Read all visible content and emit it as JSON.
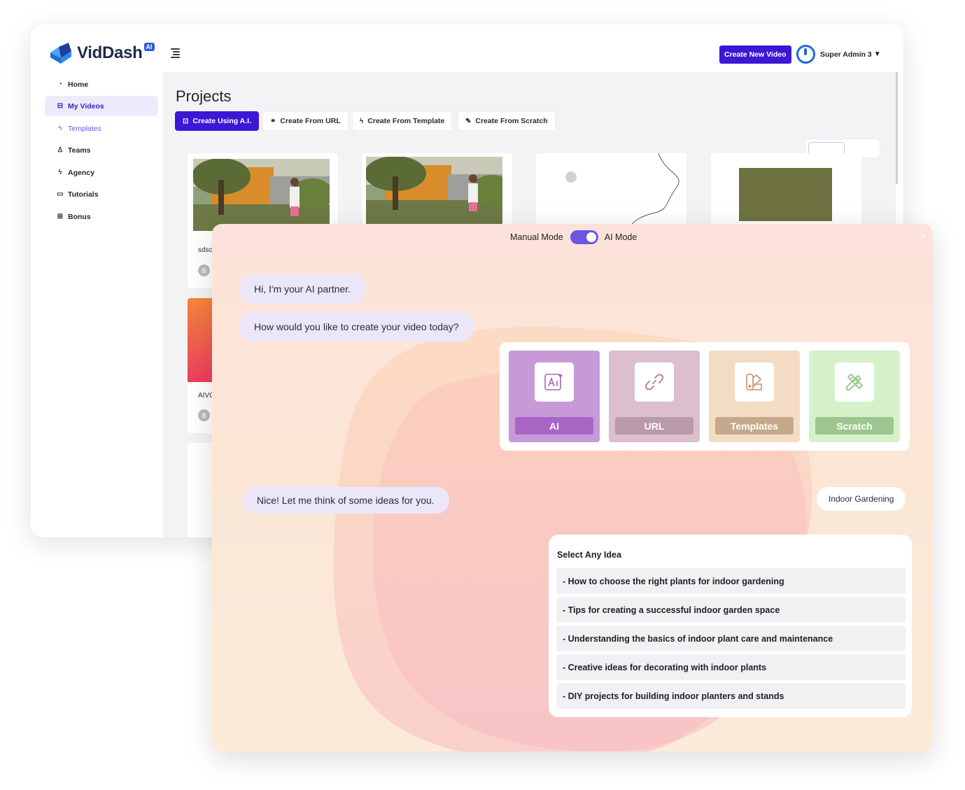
{
  "app": {
    "brand": "VidDash",
    "brand_badge": "AI",
    "create_new_label": "Create New Video",
    "user_name": "Super Admin 3",
    "user_caret": "▼"
  },
  "sidebar": {
    "items": [
      {
        "label": "Home",
        "icon": "dashboard-icon"
      },
      {
        "label": "My Videos",
        "icon": "videos-icon",
        "active": true
      },
      {
        "label": "Templates",
        "icon": "bolt-icon"
      },
      {
        "label": "Teams",
        "icon": "user-icon"
      },
      {
        "label": "Agency",
        "icon": "bolt-icon"
      },
      {
        "label": "Tutorials",
        "icon": "video-camera-icon"
      },
      {
        "label": "Bonus",
        "icon": "gift-icon"
      }
    ]
  },
  "projects": {
    "title": "Projects",
    "tabs": [
      {
        "label": "Create Using A.I.",
        "icon": "ai-icon"
      },
      {
        "label": "Create From URL",
        "icon": "link-icon"
      },
      {
        "label": "Create From Template",
        "icon": "bolt-icon"
      },
      {
        "label": "Create From Scratch",
        "icon": "pencil-icon"
      }
    ],
    "cards": [
      {
        "title": "sdsc",
        "avatar": "S"
      },
      {
        "title": "AIVC",
        "avatar": "S"
      }
    ]
  },
  "ai_panel": {
    "close_label": "×",
    "manual_mode_label": "Manual Mode",
    "ai_mode_label": "AI Mode",
    "ai_mode_on": true,
    "messages": [
      "Hi, I'm your AI partner.",
      "How would you like to create your video today?",
      "Nice! Let me think of some ideas for you."
    ],
    "user_reply": "Indoor Gardening",
    "choices": [
      {
        "label": "AI",
        "icon": "ai-sparkle-icon",
        "bg": "#c79ad7",
        "label_bg": "#a965c6",
        "icon_color": "#a762c4"
      },
      {
        "label": "URL",
        "icon": "link-icon",
        "bg": "#dbbfcc",
        "label_bg": "#b89aa9",
        "icon_color": "#b98fa8"
      },
      {
        "label": "Templates",
        "icon": "palette-icon",
        "bg": "#f3dcc4",
        "label_bg": "#c5a98a",
        "icon_color": "#c4a280"
      },
      {
        "label": "Scratch",
        "icon": "pencil-ruler-icon",
        "bg": "#d6f1c9",
        "label_bg": "#9dc58f",
        "icon_color": "#93c488"
      }
    ],
    "ideas_title": "Select Any Idea",
    "ideas": [
      "- How to choose the right plants for indoor gardening",
      "- Tips for creating a successful indoor garden space",
      "- Understanding the basics of indoor plant care and maintenance",
      "- Creative ideas for decorating with indoor plants",
      "- DIY projects for building indoor planters and stands"
    ]
  }
}
